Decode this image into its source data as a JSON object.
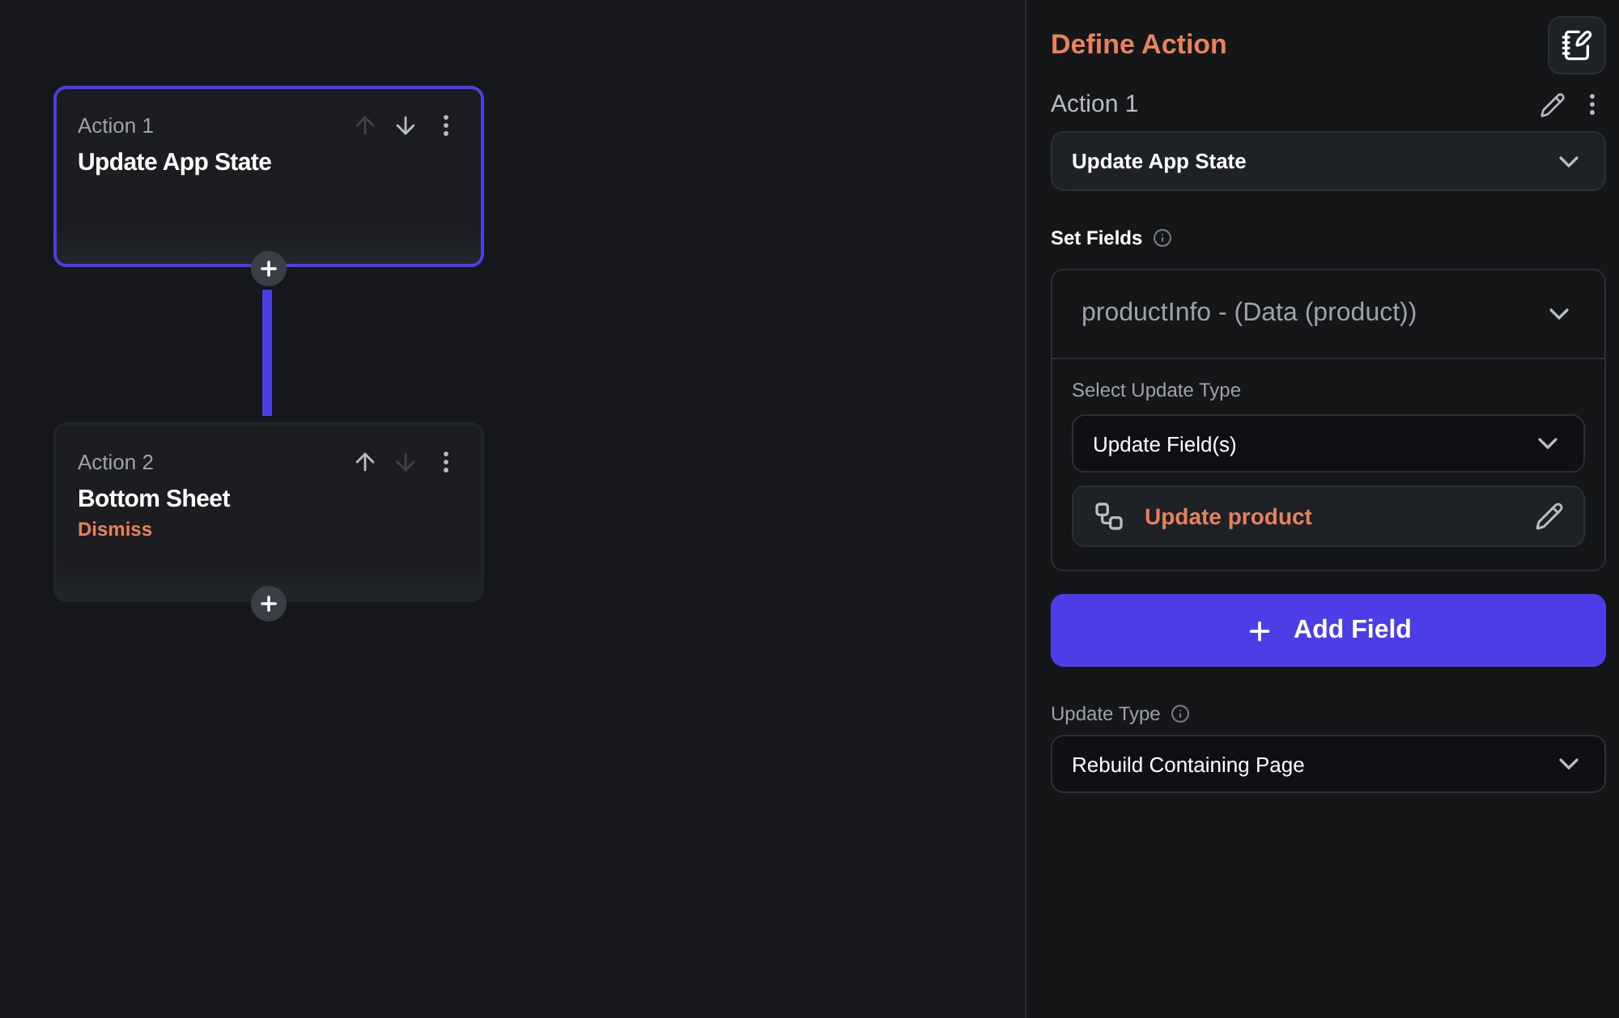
{
  "actions": [
    {
      "label": "Action 1",
      "title": "Update App State",
      "selected": true,
      "up_disabled": true,
      "down_disabled": false
    },
    {
      "label": "Action 2",
      "title": "Bottom Sheet",
      "subtitle": "Dismiss",
      "selected": false,
      "up_disabled": false,
      "down_disabled": true
    }
  ],
  "panel": {
    "title": "Define Action",
    "action_label": "Action 1",
    "action_type": "Update App State",
    "set_fields_label": "Set Fields",
    "field": {
      "name": "productInfo - (Data (product))",
      "expanded": true,
      "update_type_label": "Select Update Type",
      "update_type": "Update Field(s)",
      "update_link": "Update product"
    },
    "add_button": "Add Field",
    "update_type_label": "Update Type",
    "update_type": "Rebuild Containing Page"
  }
}
